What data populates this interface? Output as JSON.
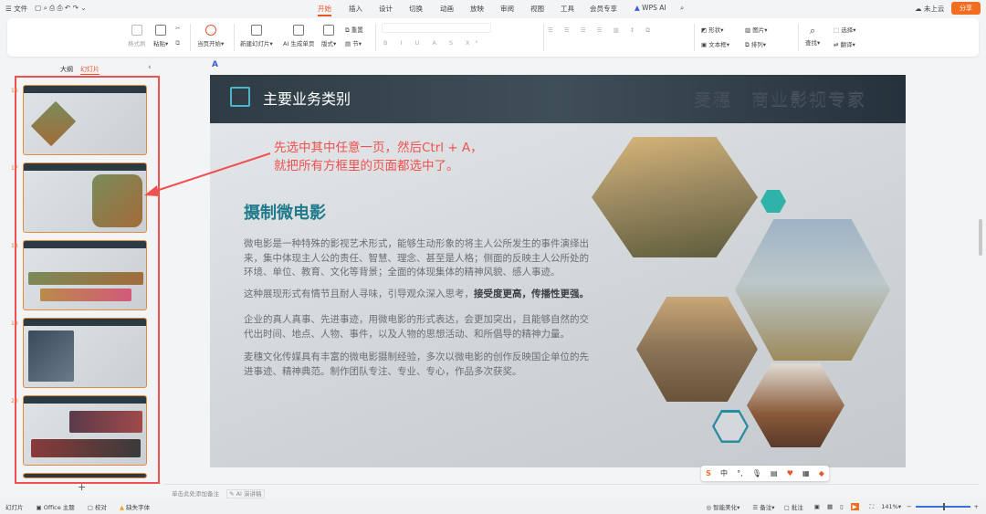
{
  "topbar": {
    "menu": "文件",
    "tabs": [
      "开始",
      "插入",
      "设计",
      "切换",
      "动画",
      "放映",
      "审阅",
      "视图",
      "工具",
      "会员专享"
    ],
    "wps_ai": "WPS AI",
    "cloud": "未上云",
    "share": "分享"
  },
  "ribbon": {
    "format_painter": "格式刷",
    "paste": "粘贴",
    "play_current": "当页开始",
    "new_slide": "新建幻灯片",
    "ai_gen": "AI 生成单页",
    "layout": "版式",
    "reset": "重置",
    "section": "节",
    "shape": "形状",
    "image": "图片",
    "textbox": "文本框",
    "arrange": "排列",
    "find": "查找",
    "select": "选择",
    "translate": "翻译"
  },
  "left": {
    "tab_outline": "大纲",
    "tab_slides": "幻灯片",
    "slide_numbers": [
      "16",
      "17",
      "18",
      "19",
      "20"
    ]
  },
  "slide": {
    "header_title": "主要业务类别",
    "watermark": "麦穗　商业影视专家",
    "annotation_line1": "先选中其中任意一页，然后Ctrl + A，",
    "annotation_line2": "就把所有方框里的页面都选中了。",
    "heading": "摄制微电影",
    "p1": "微电影是一种特殊的影视艺术形式，能够生动形象的将主人公所发生的事件演绎出来，集中体现主人公的责任、智慧、理念、甚至是人格；侧面的反映主人公所处的环境、单位、教育、文化等背景；全面的体现集体的精神风貌、感人事迹。",
    "p2_normal": "这种展现形式有情节且耐人寻味，引导观众深入思考，",
    "p2_bold": "接受度更高，传播性更强。",
    "p3": "企业的真人真事、先进事迹，用微电影的形式表达，会更加突出，且能够自然的交代出时间、地点、人物、事件，以及人物的思想活动、和所倡导的精神力量。",
    "p4": "麦穗文化传媒具有丰富的微电影摄制经验，多次以微电影的创作反映国企单位的先进事迹、精神典范。制作团队专注、专业、专心，作品多次获奖。"
  },
  "notes": {
    "placeholder": "单击此处添加备注",
    "ai_speech": "AI 演讲稿"
  },
  "ime": {
    "lang": "中"
  },
  "status": {
    "slide": "幻灯片",
    "theme": "Office 主题",
    "proof": "校对",
    "missing_font": "缺失字体",
    "smart": "智能美化",
    "notes": "备注",
    "comment": "批注",
    "zoom": "141%"
  },
  "colors": {
    "accent": "#e8542a",
    "annotation": "#f05050",
    "heading": "#1f7a8c"
  }
}
